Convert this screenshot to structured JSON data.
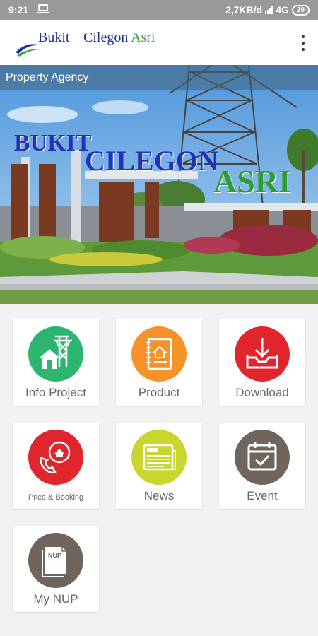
{
  "status_bar": {
    "time": "9:21",
    "network_speed": "2,7KB/d",
    "network_type": "4G",
    "battery": "29"
  },
  "app_bar": {
    "logo": {
      "word1": "Bukit",
      "word2": "Cilegon",
      "word3": "Asri"
    },
    "menu_icon": "more-vert-icon"
  },
  "hero": {
    "overlay_label": "Property Agency",
    "sign_text": [
      "BUKIT",
      "CILEGON",
      "ASRI"
    ]
  },
  "menu": {
    "items": [
      {
        "label": "Info Project",
        "icon": "house-tower-icon",
        "color": "#2bb56f"
      },
      {
        "label": "Product",
        "icon": "notebook-icon",
        "color": "#f5922a"
      },
      {
        "label": "Download",
        "icon": "download-tray-icon",
        "color": "#e0252d"
      },
      {
        "label": "Price & Booking",
        "icon": "phone-house-icon",
        "color": "#e0252d"
      },
      {
        "label": "News",
        "icon": "newspaper-icon",
        "color": "#c9d630"
      },
      {
        "label": "Event",
        "icon": "calendar-check-icon",
        "color": "#6f655c"
      },
      {
        "label": "My NUP",
        "icon": "nup-document-icon",
        "color": "#6f655c"
      }
    ],
    "nup_badge": "NUP"
  },
  "colors": {
    "status_bar": "#999999",
    "background": "#f2f2f2",
    "brand_blue": "#1f2e9c",
    "brand_green": "#3aa53a"
  }
}
